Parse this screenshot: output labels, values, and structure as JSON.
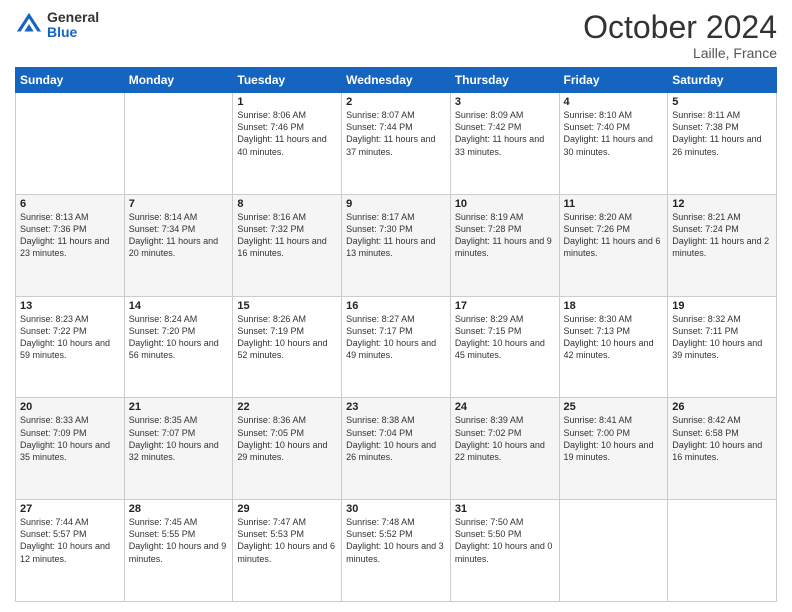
{
  "logo": {
    "general": "General",
    "blue": "Blue"
  },
  "header": {
    "month": "October 2024",
    "location": "Laille, France"
  },
  "weekdays": [
    "Sunday",
    "Monday",
    "Tuesday",
    "Wednesday",
    "Thursday",
    "Friday",
    "Saturday"
  ],
  "weeks": [
    [
      {
        "day": "",
        "sunrise": "",
        "sunset": "",
        "daylight": ""
      },
      {
        "day": "",
        "sunrise": "",
        "sunset": "",
        "daylight": ""
      },
      {
        "day": "1",
        "sunrise": "Sunrise: 8:06 AM",
        "sunset": "Sunset: 7:46 PM",
        "daylight": "Daylight: 11 hours and 40 minutes."
      },
      {
        "day": "2",
        "sunrise": "Sunrise: 8:07 AM",
        "sunset": "Sunset: 7:44 PM",
        "daylight": "Daylight: 11 hours and 37 minutes."
      },
      {
        "day": "3",
        "sunrise": "Sunrise: 8:09 AM",
        "sunset": "Sunset: 7:42 PM",
        "daylight": "Daylight: 11 hours and 33 minutes."
      },
      {
        "day": "4",
        "sunrise": "Sunrise: 8:10 AM",
        "sunset": "Sunset: 7:40 PM",
        "daylight": "Daylight: 11 hours and 30 minutes."
      },
      {
        "day": "5",
        "sunrise": "Sunrise: 8:11 AM",
        "sunset": "Sunset: 7:38 PM",
        "daylight": "Daylight: 11 hours and 26 minutes."
      }
    ],
    [
      {
        "day": "6",
        "sunrise": "Sunrise: 8:13 AM",
        "sunset": "Sunset: 7:36 PM",
        "daylight": "Daylight: 11 hours and 23 minutes."
      },
      {
        "day": "7",
        "sunrise": "Sunrise: 8:14 AM",
        "sunset": "Sunset: 7:34 PM",
        "daylight": "Daylight: 11 hours and 20 minutes."
      },
      {
        "day": "8",
        "sunrise": "Sunrise: 8:16 AM",
        "sunset": "Sunset: 7:32 PM",
        "daylight": "Daylight: 11 hours and 16 minutes."
      },
      {
        "day": "9",
        "sunrise": "Sunrise: 8:17 AM",
        "sunset": "Sunset: 7:30 PM",
        "daylight": "Daylight: 11 hours and 13 minutes."
      },
      {
        "day": "10",
        "sunrise": "Sunrise: 8:19 AM",
        "sunset": "Sunset: 7:28 PM",
        "daylight": "Daylight: 11 hours and 9 minutes."
      },
      {
        "day": "11",
        "sunrise": "Sunrise: 8:20 AM",
        "sunset": "Sunset: 7:26 PM",
        "daylight": "Daylight: 11 hours and 6 minutes."
      },
      {
        "day": "12",
        "sunrise": "Sunrise: 8:21 AM",
        "sunset": "Sunset: 7:24 PM",
        "daylight": "Daylight: 11 hours and 2 minutes."
      }
    ],
    [
      {
        "day": "13",
        "sunrise": "Sunrise: 8:23 AM",
        "sunset": "Sunset: 7:22 PM",
        "daylight": "Daylight: 10 hours and 59 minutes."
      },
      {
        "day": "14",
        "sunrise": "Sunrise: 8:24 AM",
        "sunset": "Sunset: 7:20 PM",
        "daylight": "Daylight: 10 hours and 56 minutes."
      },
      {
        "day": "15",
        "sunrise": "Sunrise: 8:26 AM",
        "sunset": "Sunset: 7:19 PM",
        "daylight": "Daylight: 10 hours and 52 minutes."
      },
      {
        "day": "16",
        "sunrise": "Sunrise: 8:27 AM",
        "sunset": "Sunset: 7:17 PM",
        "daylight": "Daylight: 10 hours and 49 minutes."
      },
      {
        "day": "17",
        "sunrise": "Sunrise: 8:29 AM",
        "sunset": "Sunset: 7:15 PM",
        "daylight": "Daylight: 10 hours and 45 minutes."
      },
      {
        "day": "18",
        "sunrise": "Sunrise: 8:30 AM",
        "sunset": "Sunset: 7:13 PM",
        "daylight": "Daylight: 10 hours and 42 minutes."
      },
      {
        "day": "19",
        "sunrise": "Sunrise: 8:32 AM",
        "sunset": "Sunset: 7:11 PM",
        "daylight": "Daylight: 10 hours and 39 minutes."
      }
    ],
    [
      {
        "day": "20",
        "sunrise": "Sunrise: 8:33 AM",
        "sunset": "Sunset: 7:09 PM",
        "daylight": "Daylight: 10 hours and 35 minutes."
      },
      {
        "day": "21",
        "sunrise": "Sunrise: 8:35 AM",
        "sunset": "Sunset: 7:07 PM",
        "daylight": "Daylight: 10 hours and 32 minutes."
      },
      {
        "day": "22",
        "sunrise": "Sunrise: 8:36 AM",
        "sunset": "Sunset: 7:05 PM",
        "daylight": "Daylight: 10 hours and 29 minutes."
      },
      {
        "day": "23",
        "sunrise": "Sunrise: 8:38 AM",
        "sunset": "Sunset: 7:04 PM",
        "daylight": "Daylight: 10 hours and 26 minutes."
      },
      {
        "day": "24",
        "sunrise": "Sunrise: 8:39 AM",
        "sunset": "Sunset: 7:02 PM",
        "daylight": "Daylight: 10 hours and 22 minutes."
      },
      {
        "day": "25",
        "sunrise": "Sunrise: 8:41 AM",
        "sunset": "Sunset: 7:00 PM",
        "daylight": "Daylight: 10 hours and 19 minutes."
      },
      {
        "day": "26",
        "sunrise": "Sunrise: 8:42 AM",
        "sunset": "Sunset: 6:58 PM",
        "daylight": "Daylight: 10 hours and 16 minutes."
      }
    ],
    [
      {
        "day": "27",
        "sunrise": "Sunrise: 7:44 AM",
        "sunset": "Sunset: 5:57 PM",
        "daylight": "Daylight: 10 hours and 12 minutes."
      },
      {
        "day": "28",
        "sunrise": "Sunrise: 7:45 AM",
        "sunset": "Sunset: 5:55 PM",
        "daylight": "Daylight: 10 hours and 9 minutes."
      },
      {
        "day": "29",
        "sunrise": "Sunrise: 7:47 AM",
        "sunset": "Sunset: 5:53 PM",
        "daylight": "Daylight: 10 hours and 6 minutes."
      },
      {
        "day": "30",
        "sunrise": "Sunrise: 7:48 AM",
        "sunset": "Sunset: 5:52 PM",
        "daylight": "Daylight: 10 hours and 3 minutes."
      },
      {
        "day": "31",
        "sunrise": "Sunrise: 7:50 AM",
        "sunset": "Sunset: 5:50 PM",
        "daylight": "Daylight: 10 hours and 0 minutes."
      },
      {
        "day": "",
        "sunrise": "",
        "sunset": "",
        "daylight": ""
      },
      {
        "day": "",
        "sunrise": "",
        "sunset": "",
        "daylight": ""
      }
    ]
  ]
}
